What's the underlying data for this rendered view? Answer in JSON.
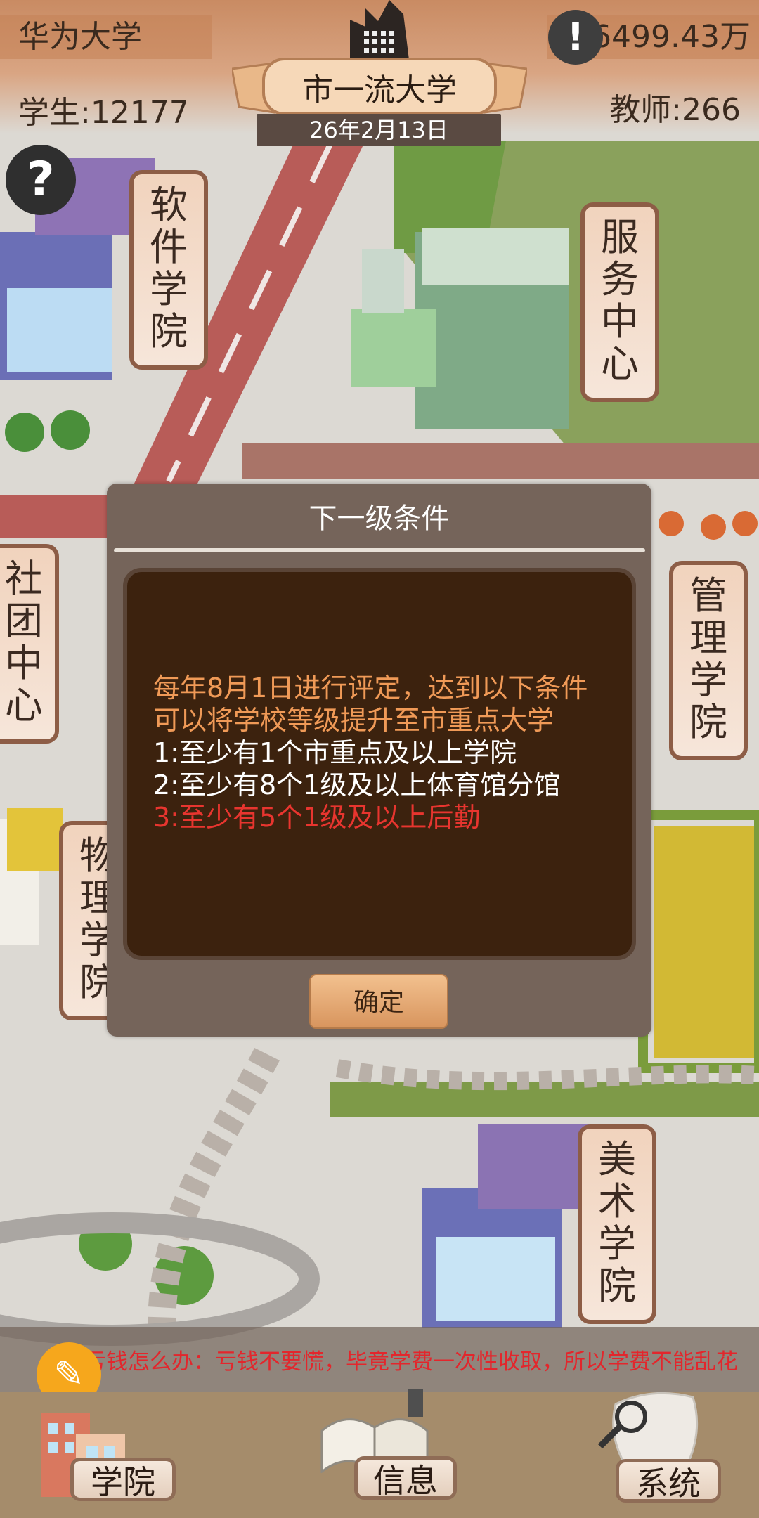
{
  "hud": {
    "school_name": "华为大学",
    "money": "6499.43万",
    "students": "学生:12177",
    "teachers": "教师:266",
    "rank_title": "市一流大学",
    "date": "26年2月13日"
  },
  "signs": {
    "software": "软件学院",
    "service": "服务中心",
    "club": "社团中心",
    "management": "管理学院",
    "physics": "物理学院",
    "arts": "美术学院"
  },
  "dialog": {
    "title": "下一级条件",
    "line1": "每年8月1日进行评定，达到以下条件",
    "line2": "可以将学校等级提升至市重点大学",
    "req1": "1:至少有1个市重点及以上学院",
    "req2": "2:至少有8个1级及以上体育馆分馆",
    "req3": "3:至少有5个1级及以上后勤",
    "ok": "确定"
  },
  "ticker": {
    "text": "亏钱怎么办：亏钱不要慌，毕竟学费一次性收取，所以学费不能乱花"
  },
  "nav": {
    "college": "学院",
    "info": "信息",
    "system": "系统"
  },
  "colors": {
    "highlight": "#f09a57",
    "normal": "#ffffff",
    "warning": "#e8352f"
  },
  "icons": [
    "help-icon",
    "alert-icon",
    "factory-icon",
    "broadcast-icon",
    "book-icon",
    "magnifier-icon",
    "building-icon"
  ]
}
